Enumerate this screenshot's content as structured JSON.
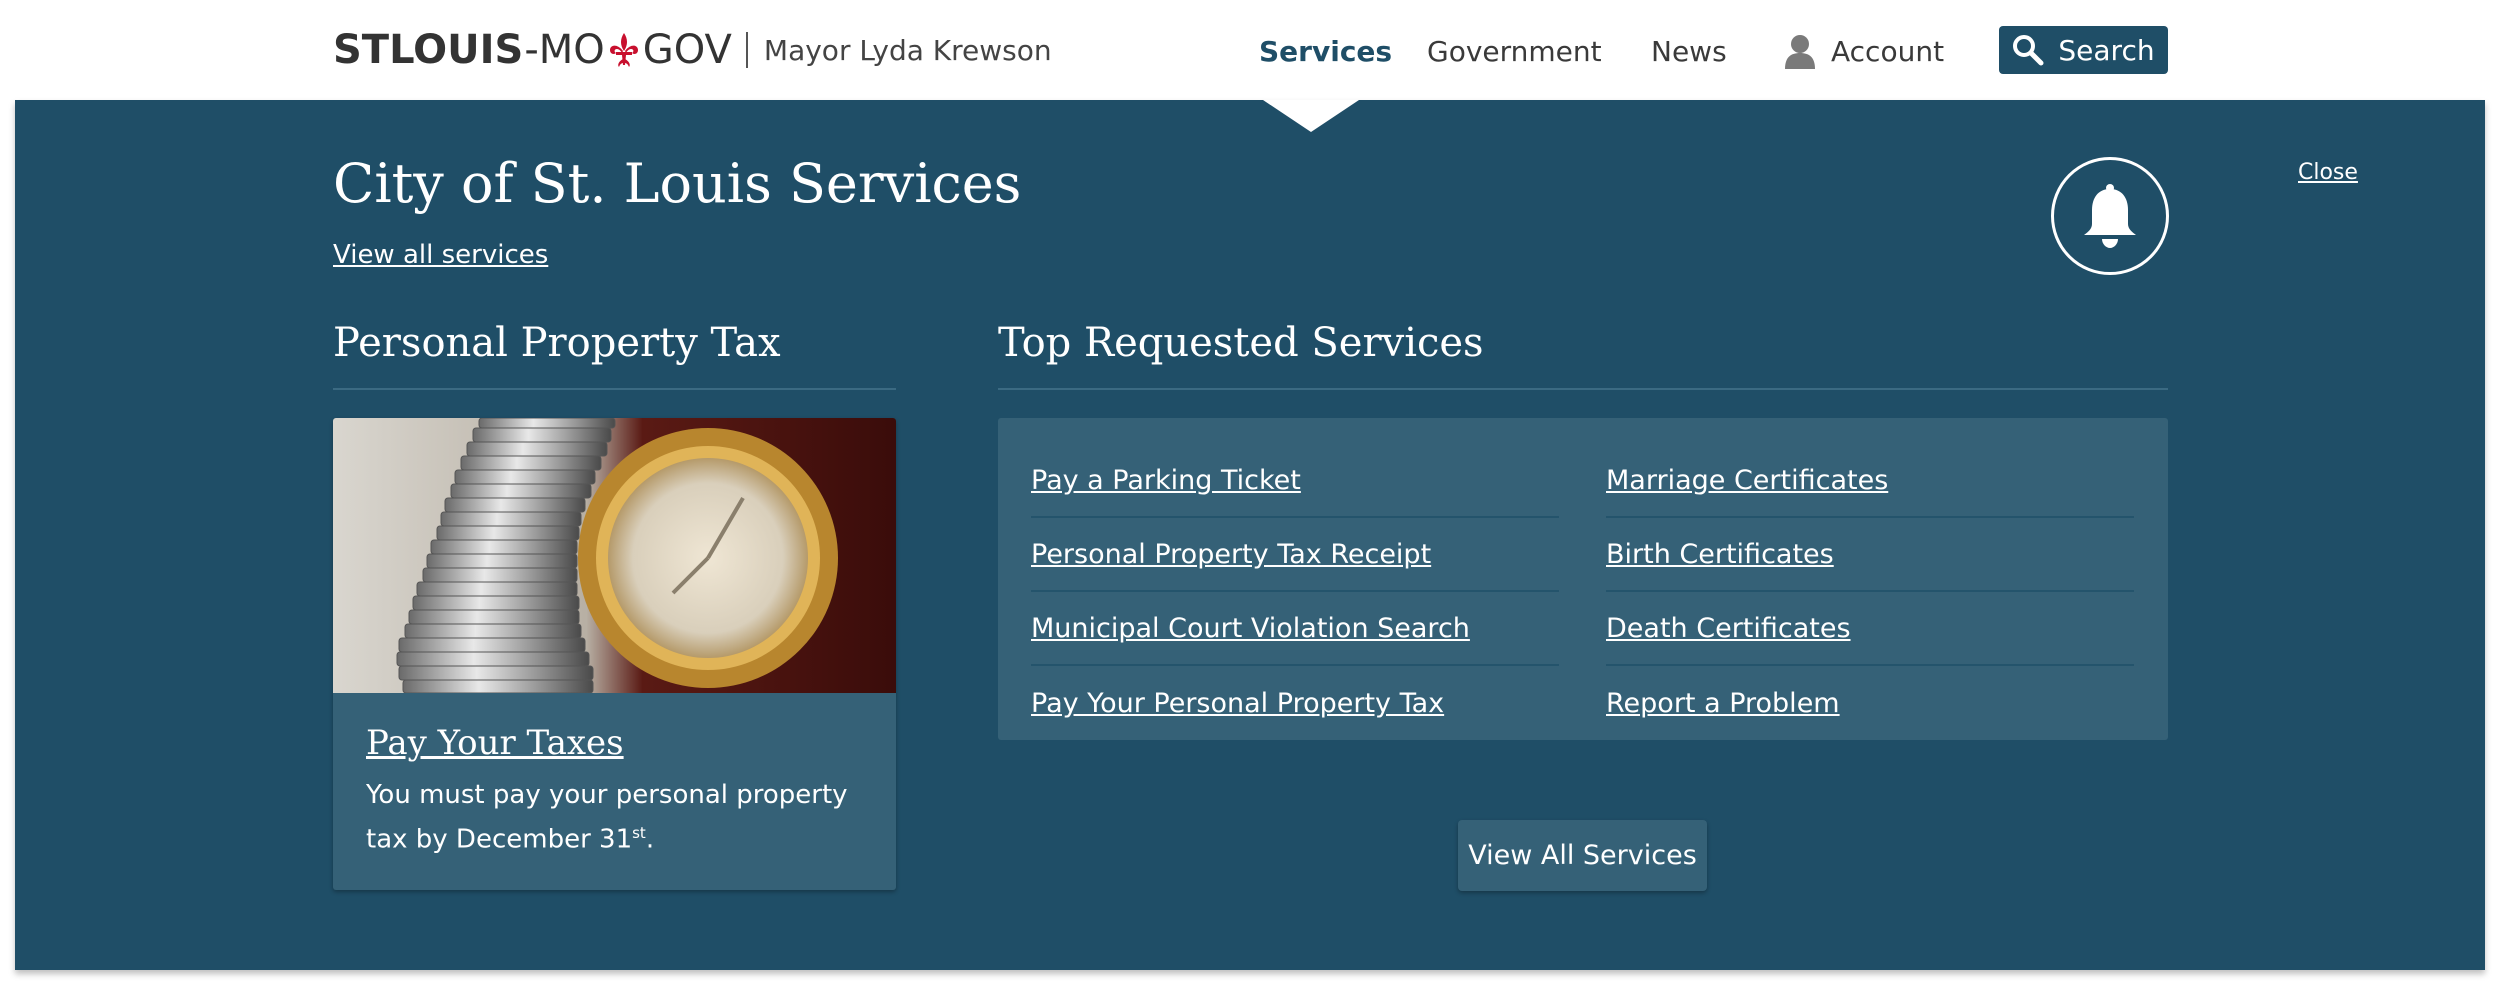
{
  "header": {
    "logo_stlouis": "STLOUIS",
    "logo_mo": "-MO",
    "logo_gov": "GOV",
    "mayor": "Mayor Lyda Krewson",
    "nav": {
      "services": "Services",
      "government": "Government",
      "news": "News",
      "account": "Account"
    },
    "search_label": "Search"
  },
  "panel": {
    "title": "City of St. Louis Services",
    "view_all_link": "View all services",
    "close_label": "Close",
    "left_section_title": "Personal Property Tax",
    "right_section_title": "Top Requested Services",
    "tax_card": {
      "link": "Pay Your Taxes",
      "desc_prefix": "You must pay your personal property tax by December 31",
      "desc_sup": "st",
      "desc_suffix": "."
    },
    "services_left": [
      "Pay a Parking Ticket",
      "Personal Property Tax Receipt",
      "Municipal Court Violation Search",
      "Pay Your Personal Property Tax"
    ],
    "services_right": [
      "Marriage Certificates",
      "Birth Certificates",
      "Death Certificates",
      "Report a Problem"
    ],
    "view_all_button": "View All Services"
  },
  "colors": {
    "panel_bg": "#1f4e67",
    "card_bg": "#356177",
    "fleur_red": "#c8102e"
  }
}
